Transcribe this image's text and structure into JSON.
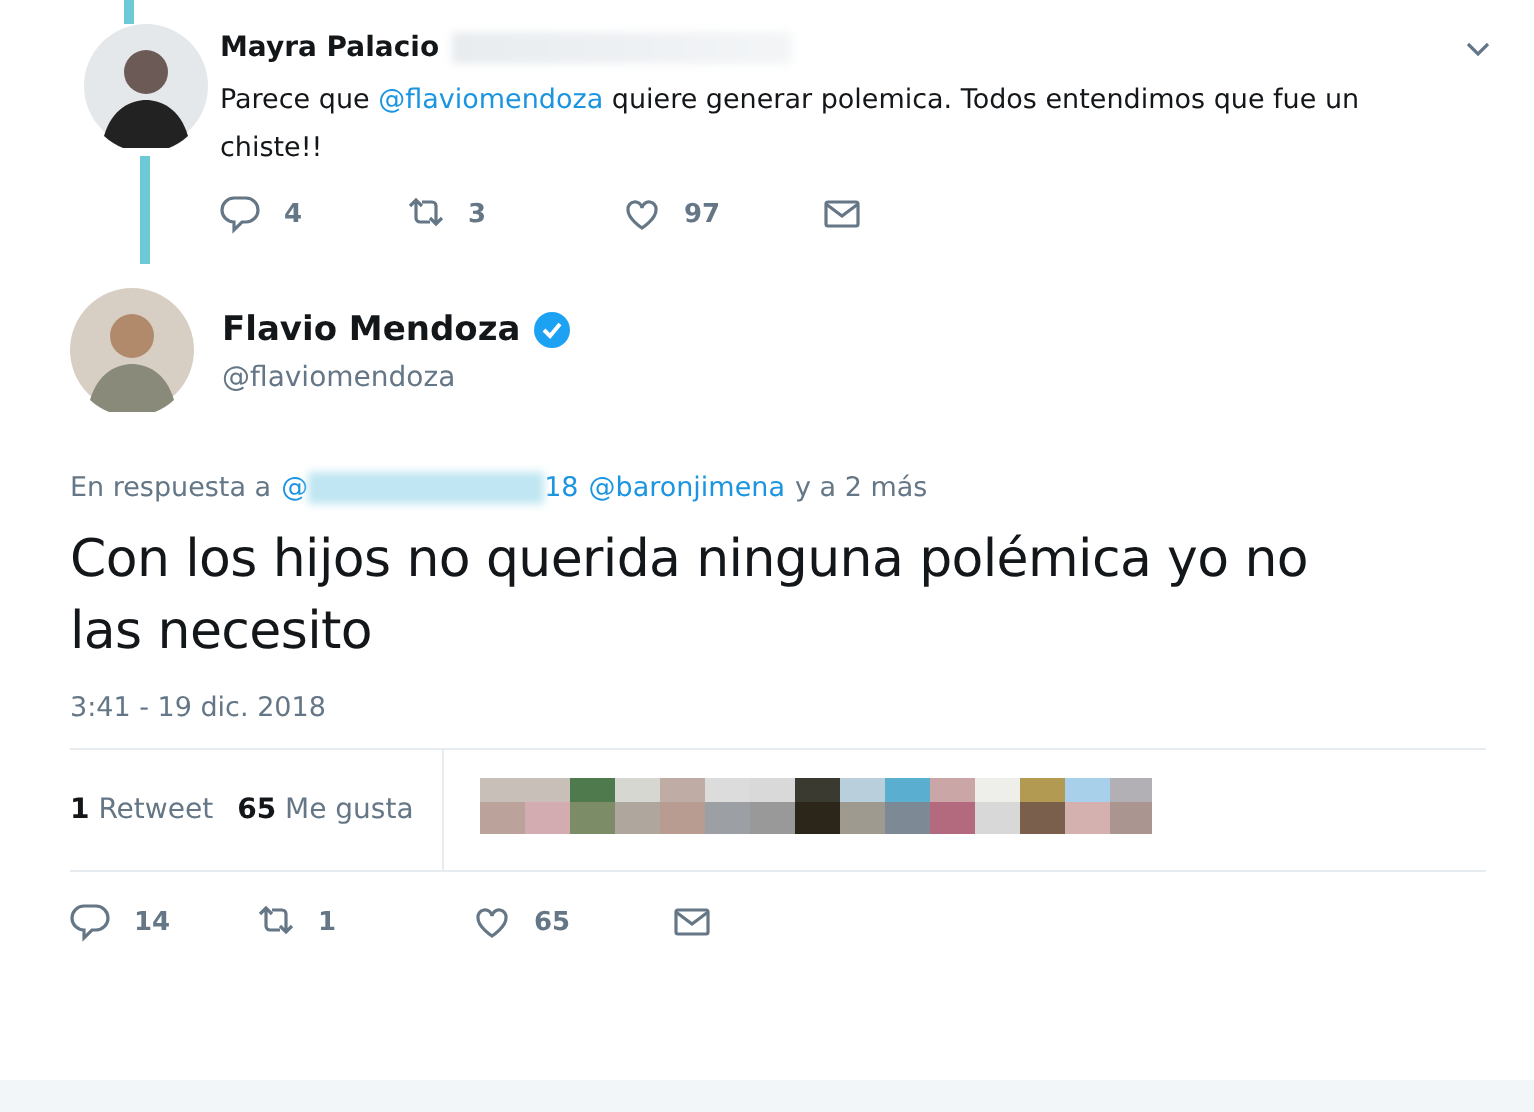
{
  "reply_tweet": {
    "name": "Mayra Palacio",
    "text_before": "Parece que ",
    "mention": "@flaviomendoza",
    "text_after": " quiere generar polemica. Todos entendimos que fue un chiste!!",
    "actions": [
      {
        "kind": "reply",
        "count": "4"
      },
      {
        "kind": "retweet",
        "count": "3"
      },
      {
        "kind": "like",
        "count": "97"
      },
      {
        "kind": "message"
      }
    ]
  },
  "main_tweet": {
    "name": "Flavio Mendoza",
    "verified": true,
    "handle": "@flaviomendoza",
    "reply_to": [
      {
        "kind": "text",
        "text": "En respuesta a"
      },
      {
        "kind": "mention",
        "text": "@"
      },
      {
        "kind": "redacted"
      },
      {
        "kind": "mention",
        "text": "18"
      },
      {
        "kind": "mention",
        "text": "@baronjimena"
      },
      {
        "kind": "text",
        "text": "y a 2 más"
      }
    ],
    "text": "Con los hijos no querida ninguna polémica yo no las necesito",
    "time": "3:41 - 19 dic. 2018",
    "stats": [
      {
        "count": "1",
        "label": "Retweet"
      },
      {
        "count": "65",
        "label": "Me gusta"
      }
    ],
    "actions": [
      {
        "kind": "reply",
        "count": "14"
      },
      {
        "kind": "retweet",
        "count": "1"
      },
      {
        "kind": "like",
        "count": "65"
      },
      {
        "kind": "message"
      }
    ]
  }
}
